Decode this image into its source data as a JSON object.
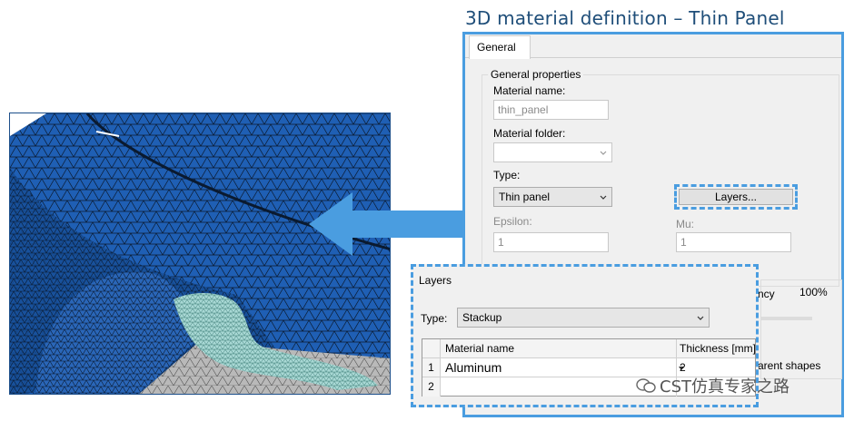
{
  "title": "3D material definition – Thin Panel",
  "dialog": {
    "tab_general": "General",
    "group_label": "General properties",
    "material_name_label": "Material name:",
    "material_name_value": "thin_panel",
    "material_folder_label": "Material folder:",
    "material_folder_value": "",
    "type_label": "Type:",
    "type_value": "Thin panel",
    "layers_button": "Layers...",
    "epsilon_label": "Epsilon:",
    "epsilon_value": "1",
    "mu_label": "Mu:",
    "mu_value": "1",
    "transparency_partial": "ncy",
    "transparency_value": "100%",
    "transparent_partial": "arent shapes"
  },
  "layers_dialog": {
    "title": "Layers",
    "type_label": "Type:",
    "type_value": "Stackup",
    "columns": [
      "Material name",
      "Thickness [mm]"
    ],
    "rows": [
      {
        "num": "1",
        "material": "Aluminum",
        "thickness": "2"
      },
      {
        "num": "2",
        "material": "",
        "thickness": ""
      }
    ]
  },
  "watermark": "CST仿真专家之路",
  "colors": {
    "accent": "#4a9de0",
    "title": "#1f4e79",
    "mesh_blue": "#1f5fb4",
    "panel": "#a8d8d4"
  }
}
